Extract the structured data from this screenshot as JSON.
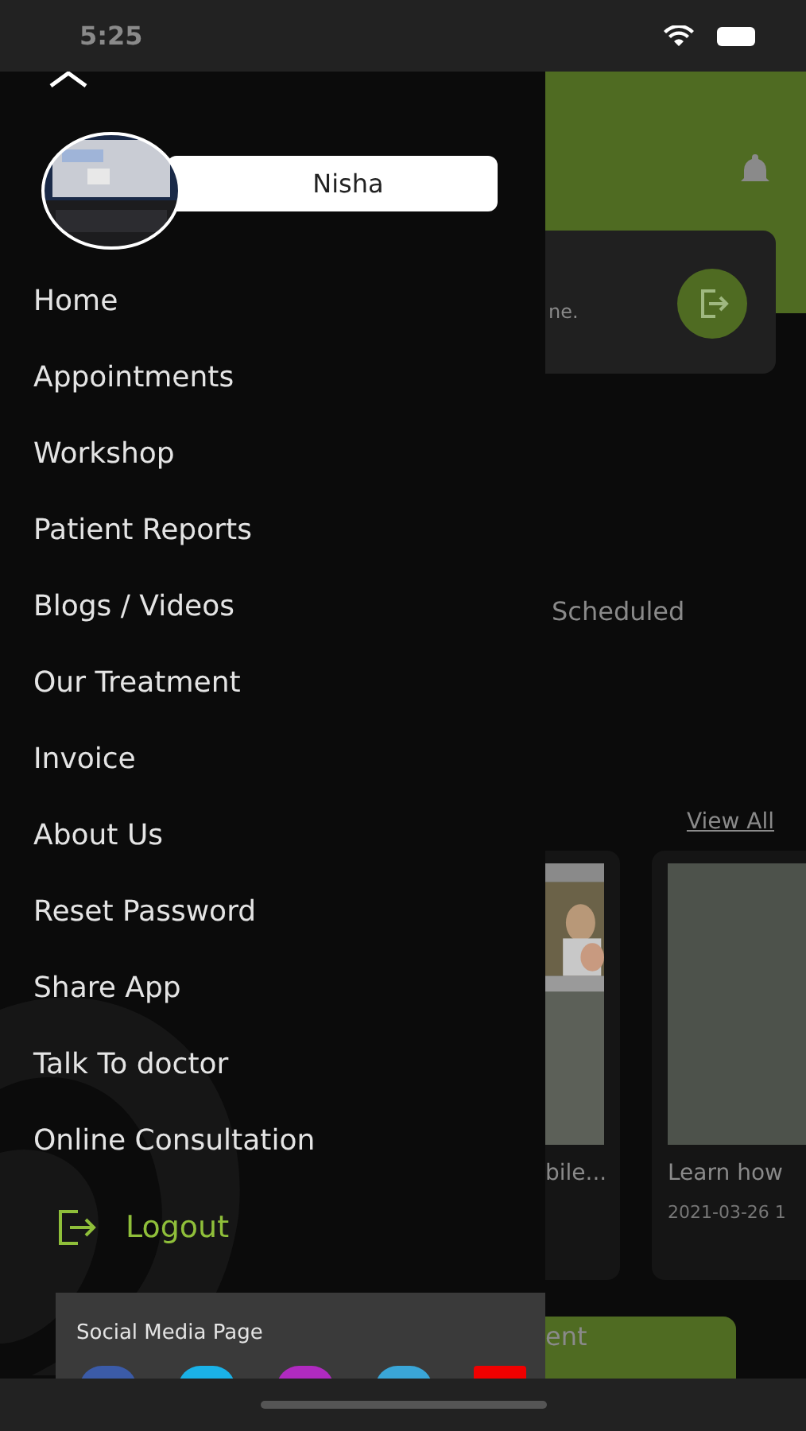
{
  "status_bar": {
    "time": "5:25"
  },
  "background_page": {
    "card_text": "ne.",
    "section_label": "Scheduled",
    "view_all": "View All",
    "videos": [
      {
        "kind": "picture",
        "title": "bile..."
      },
      {
        "kind": "placeholder",
        "title": "Learn how",
        "date": "2021-03-26 1"
      }
    ],
    "button": "ent"
  },
  "drawer": {
    "user_name": "Nisha",
    "menu": [
      {
        "label": "Home"
      },
      {
        "label": "Appointments"
      },
      {
        "label": "Workshop"
      },
      {
        "label": "Patient Reports"
      },
      {
        "label": "Blogs / Videos"
      },
      {
        "label": "Our Treatment"
      },
      {
        "label": "Invoice"
      },
      {
        "label": "About Us"
      },
      {
        "label": "Reset Password"
      },
      {
        "label": "Share App"
      },
      {
        "label": "Talk To doctor"
      },
      {
        "label": "Online Consultation"
      }
    ],
    "logout": "Logout",
    "social": {
      "title": "Social Media Page",
      "icons": [
        {
          "color": "#3b5ba8"
        },
        {
          "color": "#1ab2e8"
        },
        {
          "color": "#b02ac0"
        },
        {
          "color": "#3aa6d8"
        },
        {
          "color": "#f00000"
        }
      ]
    }
  }
}
